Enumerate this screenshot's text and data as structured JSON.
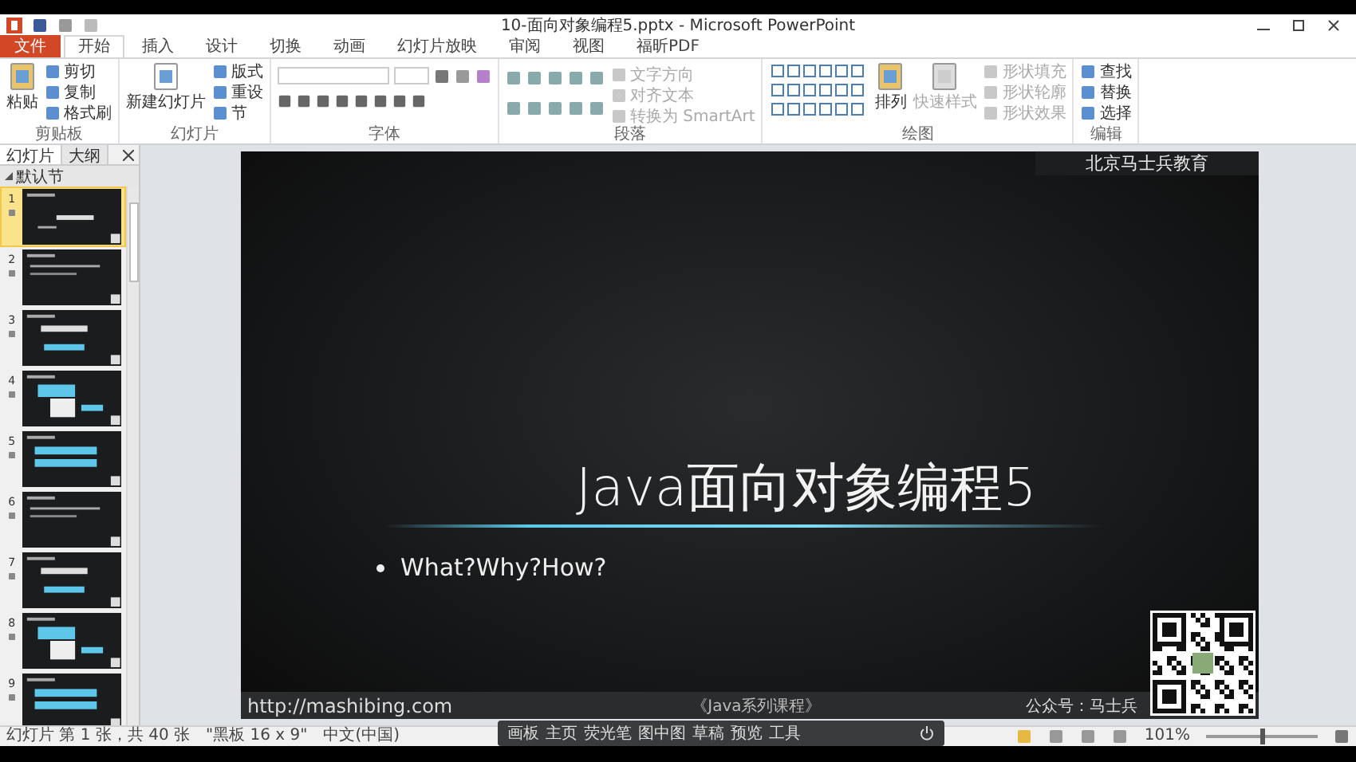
{
  "window": {
    "title": "10-面向对象编程5.pptx - Microsoft PowerPoint"
  },
  "ribbon_tabs": [
    {
      "label": "文件",
      "kind": "file",
      "selected": false
    },
    {
      "label": "开始",
      "kind": "tab",
      "selected": true
    },
    {
      "label": "插入",
      "kind": "tab",
      "selected": false
    },
    {
      "label": "设计",
      "kind": "tab",
      "selected": false
    },
    {
      "label": "切换",
      "kind": "tab",
      "selected": false
    },
    {
      "label": "动画",
      "kind": "tab",
      "selected": false
    },
    {
      "label": "幻灯片放映",
      "kind": "tab",
      "selected": false
    },
    {
      "label": "审阅",
      "kind": "tab",
      "selected": false
    },
    {
      "label": "视图",
      "kind": "tab",
      "selected": false
    },
    {
      "label": "福昕PDF",
      "kind": "tab",
      "selected": false
    }
  ],
  "ribbon_groups": [
    {
      "kind": "clipboard",
      "label": "剪贴板",
      "large": [
        {
          "label": "粘贴",
          "disabled": false
        }
      ],
      "small": [
        {
          "label": "剪切",
          "disabled": false
        },
        {
          "label": "复制",
          "disabled": false
        },
        {
          "label": "格式刷",
          "disabled": false
        }
      ]
    },
    {
      "kind": "slides",
      "label": "幻灯片",
      "large": [
        {
          "label": "新建幻灯片",
          "disabled": false
        }
      ],
      "small": [
        {
          "label": "版式",
          "disabled": false
        },
        {
          "label": "重设",
          "disabled": false
        },
        {
          "label": "节",
          "disabled": false
        }
      ]
    },
    {
      "kind": "font",
      "label": "字体"
    },
    {
      "kind": "paragraph",
      "label": "段落",
      "small": [
        {
          "label": "文字方向",
          "disabled": true
        },
        {
          "label": "对齐文本",
          "disabled": true
        },
        {
          "label": "转换为 SmartArt",
          "disabled": true
        }
      ]
    },
    {
      "kind": "drawing",
      "label": "绘图",
      "large": [
        {
          "label": "排列",
          "disabled": false
        },
        {
          "label": "快速样式",
          "disabled": true
        }
      ],
      "small": [
        {
          "label": "形状填充",
          "disabled": true
        },
        {
          "label": "形状轮廓",
          "disabled": true
        },
        {
          "label": "形状效果",
          "disabled": true
        }
      ]
    },
    {
      "kind": "editing",
      "label": "编辑",
      "small": [
        {
          "label": "查找",
          "disabled": false
        },
        {
          "label": "替换",
          "disabled": false
        },
        {
          "label": "选择",
          "disabled": false
        }
      ]
    }
  ],
  "side_panel": {
    "tabs": [
      {
        "label": "幻灯片",
        "selected": true
      },
      {
        "label": "大纲",
        "selected": false
      }
    ],
    "section": "默认节",
    "slides": [
      {
        "number": "1",
        "selected": true
      },
      {
        "number": "2",
        "selected": false
      },
      {
        "number": "3",
        "selected": false
      },
      {
        "number": "4",
        "selected": false
      },
      {
        "number": "5",
        "selected": false
      },
      {
        "number": "6",
        "selected": false
      },
      {
        "number": "7",
        "selected": false
      },
      {
        "number": "8",
        "selected": false
      },
      {
        "number": "9",
        "selected": false
      }
    ]
  },
  "slide": {
    "header": "北京马士兵教育",
    "title": "Java面向对象编程5",
    "bullets": [
      "What?Why?How?"
    ],
    "footer_left": "http://mashibing.com",
    "footer_center": "《Java系列课程》",
    "footer_right": "公众号：马士兵"
  },
  "float_toolbar": {
    "items": [
      "画板",
      "主页",
      "荧光笔",
      "图中图",
      "草稿",
      "预览",
      "工具"
    ]
  },
  "status_bar": {
    "slide_info": "幻灯片 第 1 张，共 40 张",
    "theme": "\"黑板 16 x 9\"",
    "language": "中文(中国)",
    "zoom": "101%",
    "zoom_slider": {
      "level": 0.5
    }
  }
}
